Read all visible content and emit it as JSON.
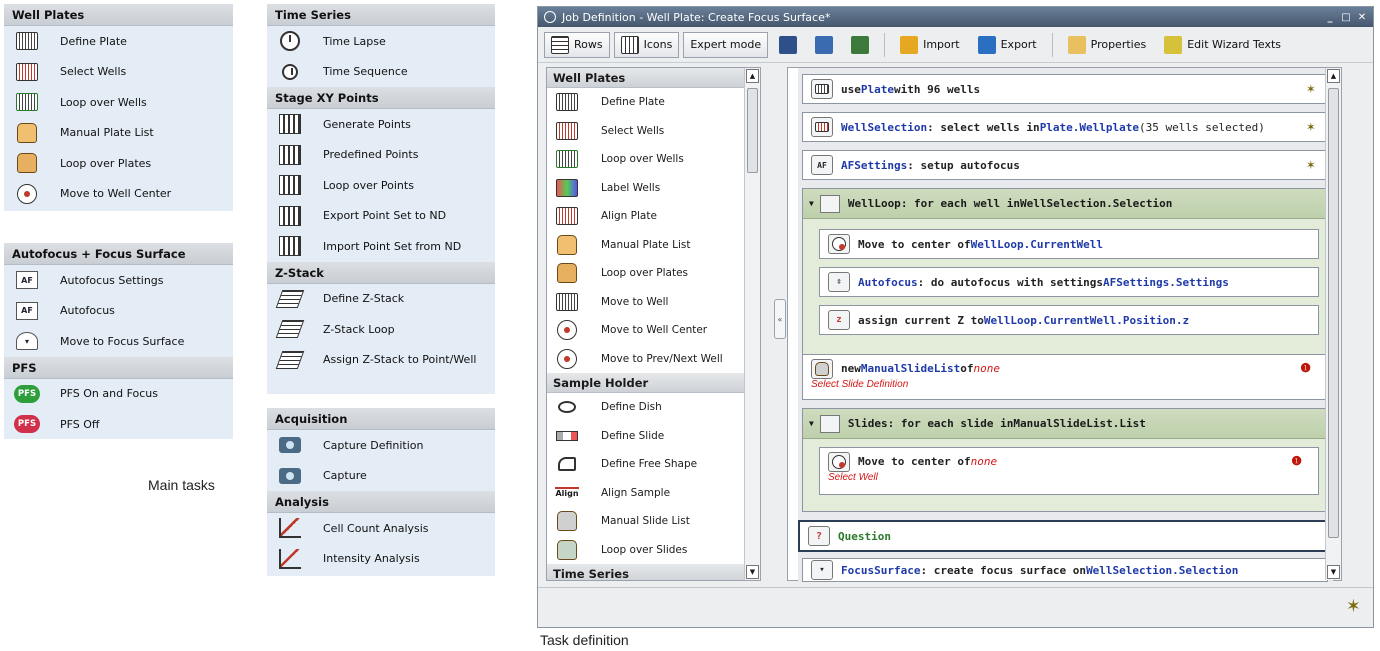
{
  "left_panels": {
    "well_plates": {
      "header": "Well Plates",
      "items": [
        {
          "label": "Define Plate",
          "icon": "plate-icon"
        },
        {
          "label": "Select Wells",
          "icon": "select-wells-icon"
        },
        {
          "label": "Loop over Wells",
          "icon": "loop-wells-icon"
        },
        {
          "label": "Manual Plate List",
          "icon": "manual-list-icon"
        },
        {
          "label": "Loop over Plates",
          "icon": "loop-plates-icon"
        },
        {
          "label": "Move to Well Center",
          "icon": "target-icon"
        }
      ]
    },
    "autofocus": {
      "header": "Autofocus + Focus Surface",
      "items": [
        {
          "label": "Autofocus Settings",
          "icon": "af-settings-icon"
        },
        {
          "label": "Autofocus",
          "icon": "af-icon"
        },
        {
          "label": "Move to Focus Surface",
          "icon": "focus-surface-icon"
        }
      ]
    },
    "pfs": {
      "header": "PFS",
      "items": [
        {
          "label": "PFS On and Focus",
          "badge": "PFS",
          "color": "#2e9e3a"
        },
        {
          "label": "PFS Off",
          "badge": "PFS",
          "color": "#d0304a"
        }
      ]
    },
    "caption": "Main tasks"
  },
  "middle_panels": {
    "time_series": {
      "header": "Time Series",
      "items": [
        {
          "label": "Time Lapse",
          "icon": "clock-icon"
        },
        {
          "label": "Time Sequence",
          "icon": "clocks-icon"
        }
      ]
    },
    "stage_xy": {
      "header": "Stage XY Points",
      "items": [
        {
          "label": "Generate Points",
          "icon": "generate-points-icon"
        },
        {
          "label": "Predefined Points",
          "icon": "predefined-points-icon"
        },
        {
          "label": "Loop over Points",
          "icon": "loop-points-icon"
        },
        {
          "label": "Export Point Set to ND",
          "icon": "export-nd-icon"
        },
        {
          "label": "Import Point Set from ND",
          "icon": "import-nd-icon"
        }
      ]
    },
    "z_stack": {
      "header": "Z-Stack",
      "items": [
        {
          "label": "Define Z-Stack",
          "icon": "zstack-icon"
        },
        {
          "label": "Z-Stack Loop",
          "icon": "zstack-loop-icon"
        },
        {
          "label": "Assign Z-Stack to Point/Well",
          "icon": "zstack-assign-icon"
        }
      ]
    },
    "acquisition": {
      "header": "Acquisition",
      "items": [
        {
          "label": "Capture Definition",
          "icon": "capture-def-icon"
        },
        {
          "label": "Capture",
          "icon": "camera-icon"
        }
      ]
    },
    "analysis": {
      "header": "Analysis",
      "items": [
        {
          "label": "Cell Count Analysis",
          "icon": "cell-count-icon"
        },
        {
          "label": "Intensity Analysis",
          "icon": "intensity-icon"
        }
      ]
    }
  },
  "window": {
    "title": "Job Definition - Well Plate: Create Focus Surface*",
    "controls": [
      "_",
      "□",
      "✕"
    ],
    "toolbar": {
      "rows": "Rows",
      "icons": "Icons",
      "expert": "Expert mode",
      "import": "Import",
      "export": "Export",
      "properties": "Properties",
      "edit_wizard": "Edit Wizard Texts"
    },
    "list": {
      "sections": [
        {
          "header": "Well Plates",
          "items": [
            "Define Plate",
            "Select Wells",
            "Loop over Wells",
            "Label Wells",
            "Align Plate",
            "Manual Plate List",
            "Loop over Plates",
            "Move to Well",
            "Move to Well Center",
            "Move to Prev/Next Well"
          ]
        },
        {
          "header": "Sample Holder",
          "items": [
            "Define Dish",
            "Define Slide",
            "Define Free Shape",
            "Align Sample",
            "Manual Slide List",
            "Loop over Slides"
          ]
        },
        {
          "header": "Time Series",
          "items": []
        }
      ]
    },
    "workflow": {
      "step1": {
        "a": "use ",
        "b": "Plate",
        "c": " with 96 wells"
      },
      "step2": {
        "a": "WellSelection",
        "b": " : select wells in ",
        "c": "Plate.Wellplate",
        "d": " (35 wells selected)"
      },
      "step3": {
        "a": "AFSettings",
        "b": " : setup autofocus"
      },
      "loop1": {
        "a": "WellLoop",
        "b": " : for each well in ",
        "c": "WellSelection.Selection"
      },
      "loop1_step1": {
        "a": "Move to center of ",
        "b": "WellLoop.CurrentWell"
      },
      "loop1_step2": {
        "a": "Autofocus",
        "b": " : do autofocus with settings ",
        "c": "AFSettings.Settings"
      },
      "loop1_step3": {
        "a": "assign current Z to ",
        "b": "WellLoop.CurrentWell.Position.z"
      },
      "step4": {
        "a": "new ",
        "b": "ManualSlideList",
        "c": " of ",
        "d": "none",
        "sub": "Select Slide Definition"
      },
      "loop2": {
        "a": "Slides",
        "b": " : for each slide in ",
        "c": "ManualSlideList.List"
      },
      "loop2_step1": {
        "a": "Move to center of ",
        "b": "none",
        "sub": "Select Well"
      },
      "question": "Question",
      "step5": {
        "a": "FocusSurface",
        "b": " : create focus surface on ",
        "c": "WellSelection.Selection"
      }
    },
    "caption": "Task definition"
  }
}
